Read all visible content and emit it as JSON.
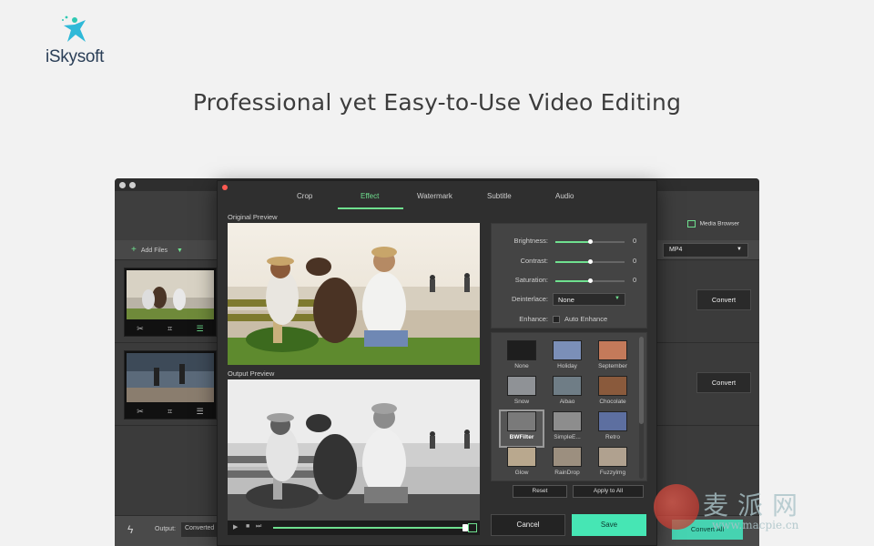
{
  "brand": {
    "name": "iSkysoft"
  },
  "headline": "Professional yet Easy-to-Use Video Editing",
  "main_window": {
    "toolbar": {
      "add_files": "Add Files",
      "media_browser": "Media Browser",
      "format": "MP4"
    },
    "rows": [
      {
        "convert": "Convert"
      },
      {
        "convert": "Convert"
      }
    ],
    "bottom": {
      "output_label": "Output:",
      "output_value": "Converted",
      "convert_all": "Convert All"
    }
  },
  "dialog": {
    "tabs": [
      "Crop",
      "Effect",
      "Watermark",
      "Subtitle",
      "Audio"
    ],
    "active_tab": "Effect",
    "original_preview": "Original Preview",
    "output_preview": "Output Preview",
    "adjustments": {
      "brightness": {
        "label": "Brightness:",
        "value": "0",
        "level": 0.5
      },
      "contrast": {
        "label": "Contrast:",
        "value": "0",
        "level": 0.5
      },
      "saturation": {
        "label": "Saturation:",
        "value": "0",
        "level": 0.5
      },
      "deinterlace": {
        "label": "Deinterlace:",
        "value": "None"
      },
      "enhance": {
        "label": "Enhance:",
        "option": "Auto Enhance",
        "checked": false
      }
    },
    "filters": [
      {
        "name": "None",
        "color": "#1e1e1e"
      },
      {
        "name": "Holiday",
        "color": "#7b8fb8"
      },
      {
        "name": "September",
        "color": "#c47a5a"
      },
      {
        "name": "Snow",
        "color": "#8f9296"
      },
      {
        "name": "Aibao",
        "color": "#6f7d86"
      },
      {
        "name": "Chocolate",
        "color": "#8a5a3c"
      },
      {
        "name": "BWFilter",
        "color": "#7a7a7a"
      },
      {
        "name": "SimpleE...",
        "color": "#8d8d8d"
      },
      {
        "name": "Retro",
        "color": "#5d6fa0"
      },
      {
        "name": "Glow",
        "color": "#b9a88e"
      },
      {
        "name": "RainDrop",
        "color": "#9c8f7f"
      },
      {
        "name": "FuzzyImg",
        "color": "#b0a18f"
      }
    ],
    "selected_filter": "BWFilter",
    "reset": "Reset",
    "apply_to_all": "Apply to All",
    "cancel": "Cancel",
    "save": "Save",
    "playback_progress": 0.98
  },
  "watermark": {
    "chars": "麦派网",
    "url": "www.macpie.cn"
  },
  "colors": {
    "accent": "#6fe08f",
    "save": "#46e6b4",
    "close": "#ff5a52"
  }
}
